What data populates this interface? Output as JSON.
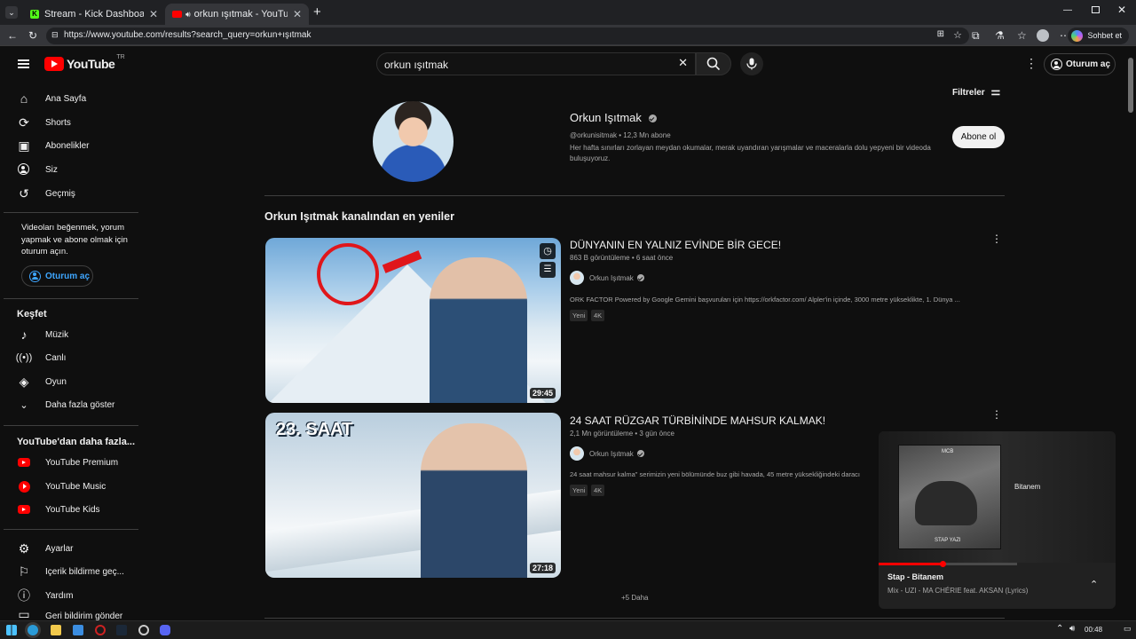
{
  "browser": {
    "tabs": [
      {
        "title": "Stream - Kick Dashboard",
        "favicon": "kick-icon"
      },
      {
        "title": "orkun ışıtmak - YouTube",
        "favicon": "youtube-icon"
      }
    ],
    "url": "https://www.youtube.com/results?search_query=orkun+ışıtmak",
    "copilot_label": "Sohbet et"
  },
  "header": {
    "logo_text": "YouTube",
    "region": "TR",
    "search_value": "orkun ışıtmak",
    "signin_label": "Oturum aç"
  },
  "sidebar": {
    "main": [
      {
        "label": "Ana Sayfa",
        "icon": "home-icon"
      },
      {
        "label": "Shorts",
        "icon": "shorts-icon"
      },
      {
        "label": "Abonelikler",
        "icon": "subscriptions-icon"
      },
      {
        "label": "Siz",
        "icon": "you-icon"
      },
      {
        "label": "Geçmiş",
        "icon": "history-icon"
      }
    ],
    "signin_prompt": "Videoları beğenmek, yorum yapmak ve abone olmak için oturum açın.",
    "signin_button": "Oturum aç",
    "explore_title": "Keşfet",
    "explore": [
      {
        "label": "Müzik",
        "icon": "music-icon"
      },
      {
        "label": "Canlı",
        "icon": "live-icon"
      },
      {
        "label": "Oyun",
        "icon": "gaming-icon"
      },
      {
        "label": "Daha fazla göster",
        "icon": "chevron-down-icon"
      }
    ],
    "more_title": "YouTube'dan daha fazla...",
    "more": [
      {
        "label": "YouTube Premium",
        "icon": "youtube-premium-icon"
      },
      {
        "label": "YouTube Music",
        "icon": "youtube-music-icon"
      },
      {
        "label": "YouTube Kids",
        "icon": "youtube-kids-icon"
      }
    ],
    "settings": [
      {
        "label": "Ayarlar",
        "icon": "gear-icon"
      },
      {
        "label": "İçerik bildirme geç...",
        "icon": "flag-icon"
      },
      {
        "label": "Yardım",
        "icon": "help-icon"
      },
      {
        "label": "Geri bildirim gönder",
        "icon": "feedback-icon"
      }
    ]
  },
  "filters_label": "Filtreler",
  "channel": {
    "name": "Orkun Işıtmak",
    "handle_subs": "@orkunisitmak • 12,3 Mn abone",
    "description": "Her hafta sınırları zorlayan meydan okumalar, merak uyandıran yarışmalar ve maceralarla dolu yepyeni bir videoda buluşuyoruz.",
    "subscribe_label": "Abone ol"
  },
  "section_title": "Orkun Işıtmak kanalından en yeniler",
  "videos": [
    {
      "title": "DÜNYANIN EN YALNIZ EVİNDE BİR GECE!",
      "meta": "863 B görüntüleme • 6 saat önce",
      "channel": "Orkun Işıtmak",
      "description": "ORK FACTOR Powered by Google Gemini başvuruları için https://orkfactor.com/ Alpler'in içinde, 3000 metre yükseklikte, 1. Dünya ...",
      "badges": [
        "Yeni",
        "4K"
      ],
      "duration": "29:45"
    },
    {
      "title": "24 SAAT RÜZGAR TÜRBİNİNDE MAHSUR KALMAK!",
      "meta": "2,1 Mn görüntüleme • 3 gün önce",
      "channel": "Orkun Işıtmak",
      "description": "24 saat mahsur kalma\" serimizin yeni bölümünde buz gibi havada, 45 metre yüksekliğindeki daracı",
      "badges": [
        "Yeni",
        "4K"
      ],
      "duration": "27:18",
      "thumb_text": "23. SAAT"
    }
  ],
  "more_label": "+5 Daha",
  "miniplayer": {
    "title": "Stap - Bitanem",
    "subtitle": "Mix - UZI - MA CHÉRIE feat. AKSAN (Lyrics)",
    "overlay_text": "Bitanem",
    "cover_top": "MCB",
    "cover_bottom": "STAP YAZI",
    "progress": 0.46
  },
  "taskbar": {
    "time": "00:48"
  }
}
